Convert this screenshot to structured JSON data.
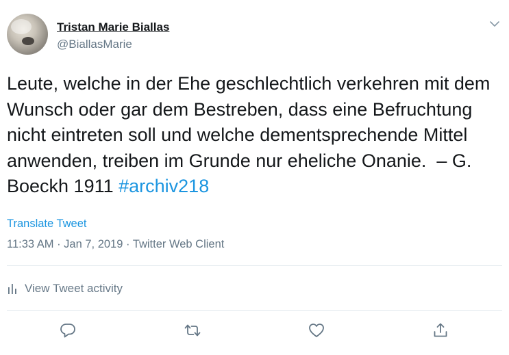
{
  "author": {
    "display_name": "Tristan Marie Biallas",
    "handle": "@BiallasMarie"
  },
  "tweet": {
    "text": "Leute, welche in der Ehe geschlechtlich verkehren mit dem Wunsch oder gar dem Bestreben, dass eine Befruchtung nicht eintreten soll und welche dementsprechende Mittel anwenden, treiben im Grunde nur eheliche Onanie.  – G. Boeckh 1911 ",
    "hashtag": "#archiv218"
  },
  "translate_label": "Translate Tweet",
  "meta": {
    "time": "11:33 AM",
    "separator": " · ",
    "date": "Jan 7, 2019",
    "source": "Twitter Web Client"
  },
  "activity_label": "View Tweet activity",
  "icons": {
    "caret": "chevron-down-icon",
    "activity": "bar-chart-icon",
    "reply": "reply-icon",
    "retweet": "retweet-icon",
    "like": "heart-icon",
    "share": "share-icon"
  },
  "colors": {
    "link": "#1b95e0",
    "secondary": "#657786",
    "primary": "#14171a",
    "divider": "#e1e8ed"
  }
}
